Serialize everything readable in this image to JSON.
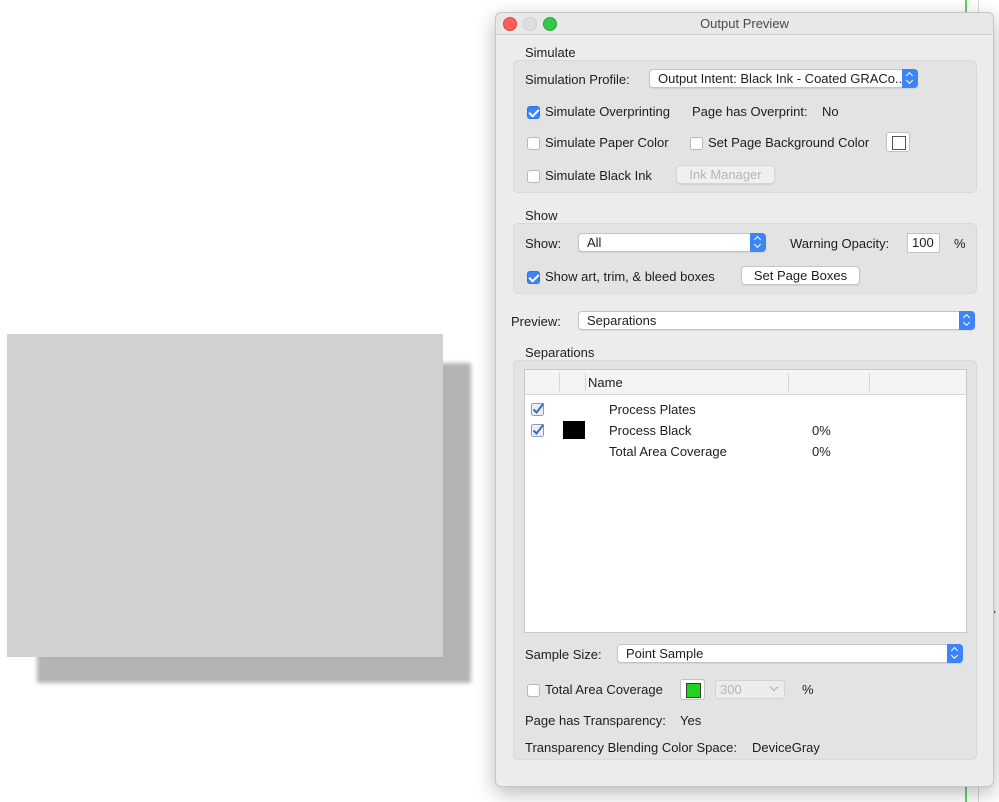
{
  "dialog": {
    "title": "Output Preview",
    "simulate": {
      "heading": "Simulate",
      "profile_label": "Simulation Profile:",
      "profile_value": "Output Intent: Black Ink - Coated GRACo...",
      "overprinting_label": "Simulate Overprinting",
      "overprinting_checked": true,
      "page_overprint_label": "Page has Overprint:",
      "page_overprint_value": "No",
      "paper_color_label": "Simulate Paper Color",
      "paper_color_checked": false,
      "bg_color_label": "Set Page Background Color",
      "bg_color_checked": false,
      "black_ink_label": "Simulate Black Ink",
      "black_ink_checked": false,
      "ink_manager_label": "Ink Manager"
    },
    "show": {
      "heading": "Show",
      "show_label": "Show:",
      "show_value": "All",
      "warning_opacity_label": "Warning Opacity:",
      "warning_opacity_value": "100",
      "percent": "%",
      "boxes_label": "Show art, trim, & bleed boxes",
      "boxes_checked": true,
      "set_page_boxes_label": "Set Page Boxes"
    },
    "preview": {
      "label": "Preview:",
      "value": "Separations"
    },
    "separations": {
      "heading": "Separations",
      "columns": [
        "Name",
        "",
        ""
      ],
      "rows": [
        {
          "name": "Process Plates",
          "value": "",
          "checked": true,
          "swatch": ""
        },
        {
          "name": "Process Black",
          "value": "0%",
          "checked": true,
          "swatch": "#000000"
        },
        {
          "name": "Total Area Coverage",
          "value": "0%",
          "checked": false,
          "swatch": ""
        }
      ]
    },
    "sample_size": {
      "label": "Sample Size:",
      "value": "Point Sample"
    },
    "tac": {
      "label": "Total Area Coverage",
      "checked": false,
      "color": "#1fd41f",
      "value": "300",
      "percent": "%"
    },
    "transparency": {
      "label": "Page has Transparency:",
      "value": "Yes"
    },
    "blend_space": {
      "label": "Transparency Blending Color Space:",
      "value": "DeviceGray"
    }
  }
}
